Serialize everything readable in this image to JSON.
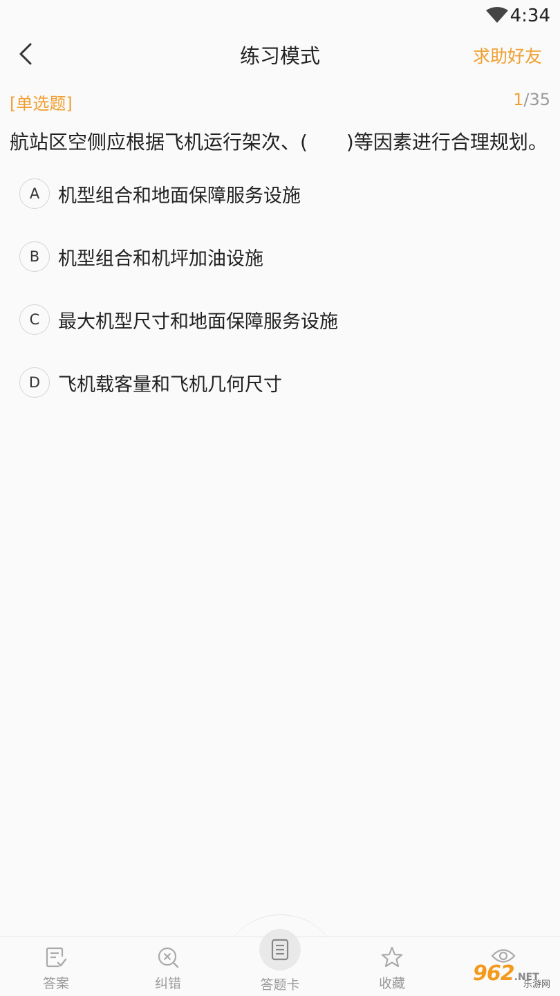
{
  "status_bar": {
    "time": "4:34"
  },
  "header": {
    "title": "练习模式",
    "help_label": "求助好友"
  },
  "question": {
    "type_label": "[单选题]",
    "current": "1",
    "total": "/35",
    "text": "航站区空侧应根据飞机运行架次、(　　)等因素进行合理规划。",
    "options": [
      {
        "letter": "A",
        "text": "机型组合和地面保障服务设施"
      },
      {
        "letter": "B",
        "text": "机型组合和机坪加油设施"
      },
      {
        "letter": "C",
        "text": "最大机型尺寸和地面保障服务设施"
      },
      {
        "letter": "D",
        "text": "飞机载客量和飞机几何尺寸"
      }
    ]
  },
  "bottom_bar": {
    "tabs": [
      {
        "label": "答案",
        "icon": "answer-icon"
      },
      {
        "label": "纠错",
        "icon": "error-icon"
      },
      {
        "label": "答题卡",
        "icon": "answer-card-icon"
      },
      {
        "label": "收藏",
        "icon": "star-icon"
      },
      {
        "label": "",
        "icon": "eye-icon"
      }
    ]
  },
  "watermark": {
    "brand": "962",
    "suffix": ".NET",
    "sub": "乐游网"
  },
  "colors": {
    "accent": "#f0a032",
    "muted": "#999999",
    "background": "#fafafa"
  }
}
